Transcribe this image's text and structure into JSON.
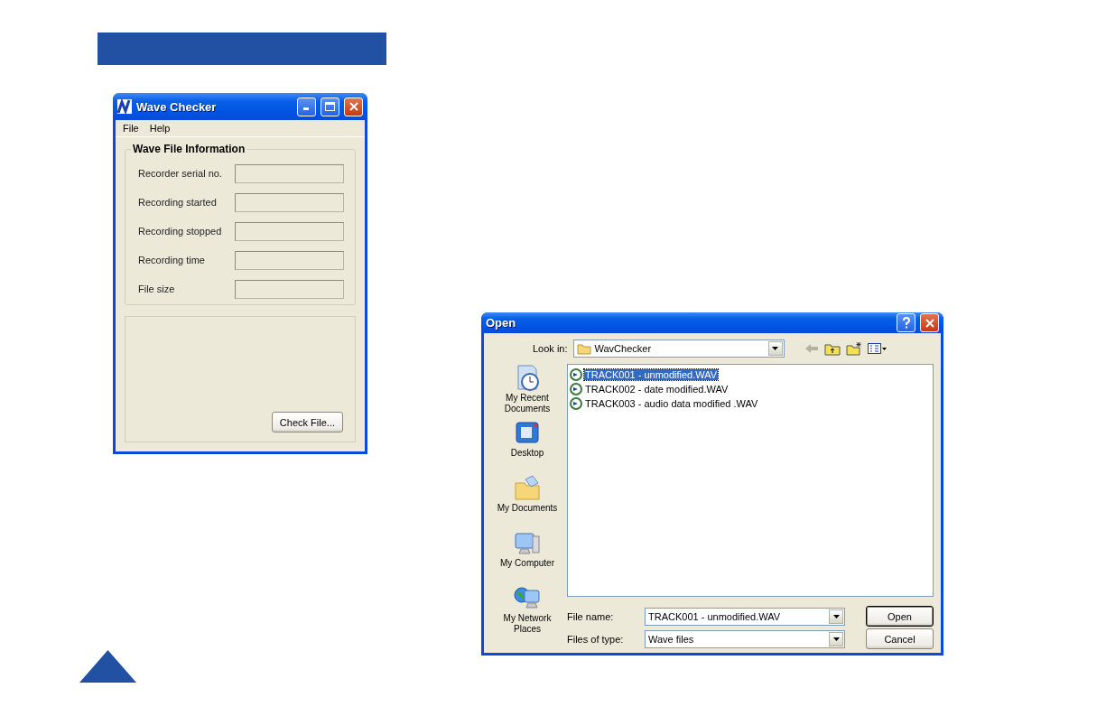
{
  "wave_checker": {
    "title": "Wave Checker",
    "menu": [
      "File",
      "Help"
    ],
    "group_title": "Wave File Information",
    "fields": [
      {
        "label": "Recorder serial no."
      },
      {
        "label": "Recording started"
      },
      {
        "label": "Recording stopped"
      },
      {
        "label": "Recording time"
      },
      {
        "label": "File size"
      }
    ],
    "button": "Check File..."
  },
  "open_dialog": {
    "title": "Open",
    "look_in_label": "Look in:",
    "look_in_value": "WavChecker",
    "places": [
      {
        "label": "My Recent Documents",
        "kind": "recent"
      },
      {
        "label": "Desktop",
        "kind": "desktop"
      },
      {
        "label": "My Documents",
        "kind": "documents"
      },
      {
        "label": "My Computer",
        "kind": "computer"
      },
      {
        "label": "My Network Places",
        "kind": "network"
      }
    ],
    "files": [
      {
        "name": "TRACK001 - unmodified.WAV",
        "selected": true
      },
      {
        "name": "TRACK002 - date modified.WAV",
        "selected": false
      },
      {
        "name": "TRACK003 - audio data modified .WAV",
        "selected": false
      }
    ],
    "file_name_label": "File name:",
    "file_name_value": "TRACK001 - unmodified.WAV",
    "file_type_label": "Files of type:",
    "file_type_value": "Wave files",
    "buttons": [
      {
        "label": "Open",
        "default": true
      },
      {
        "label": "Cancel",
        "default": false
      }
    ]
  }
}
